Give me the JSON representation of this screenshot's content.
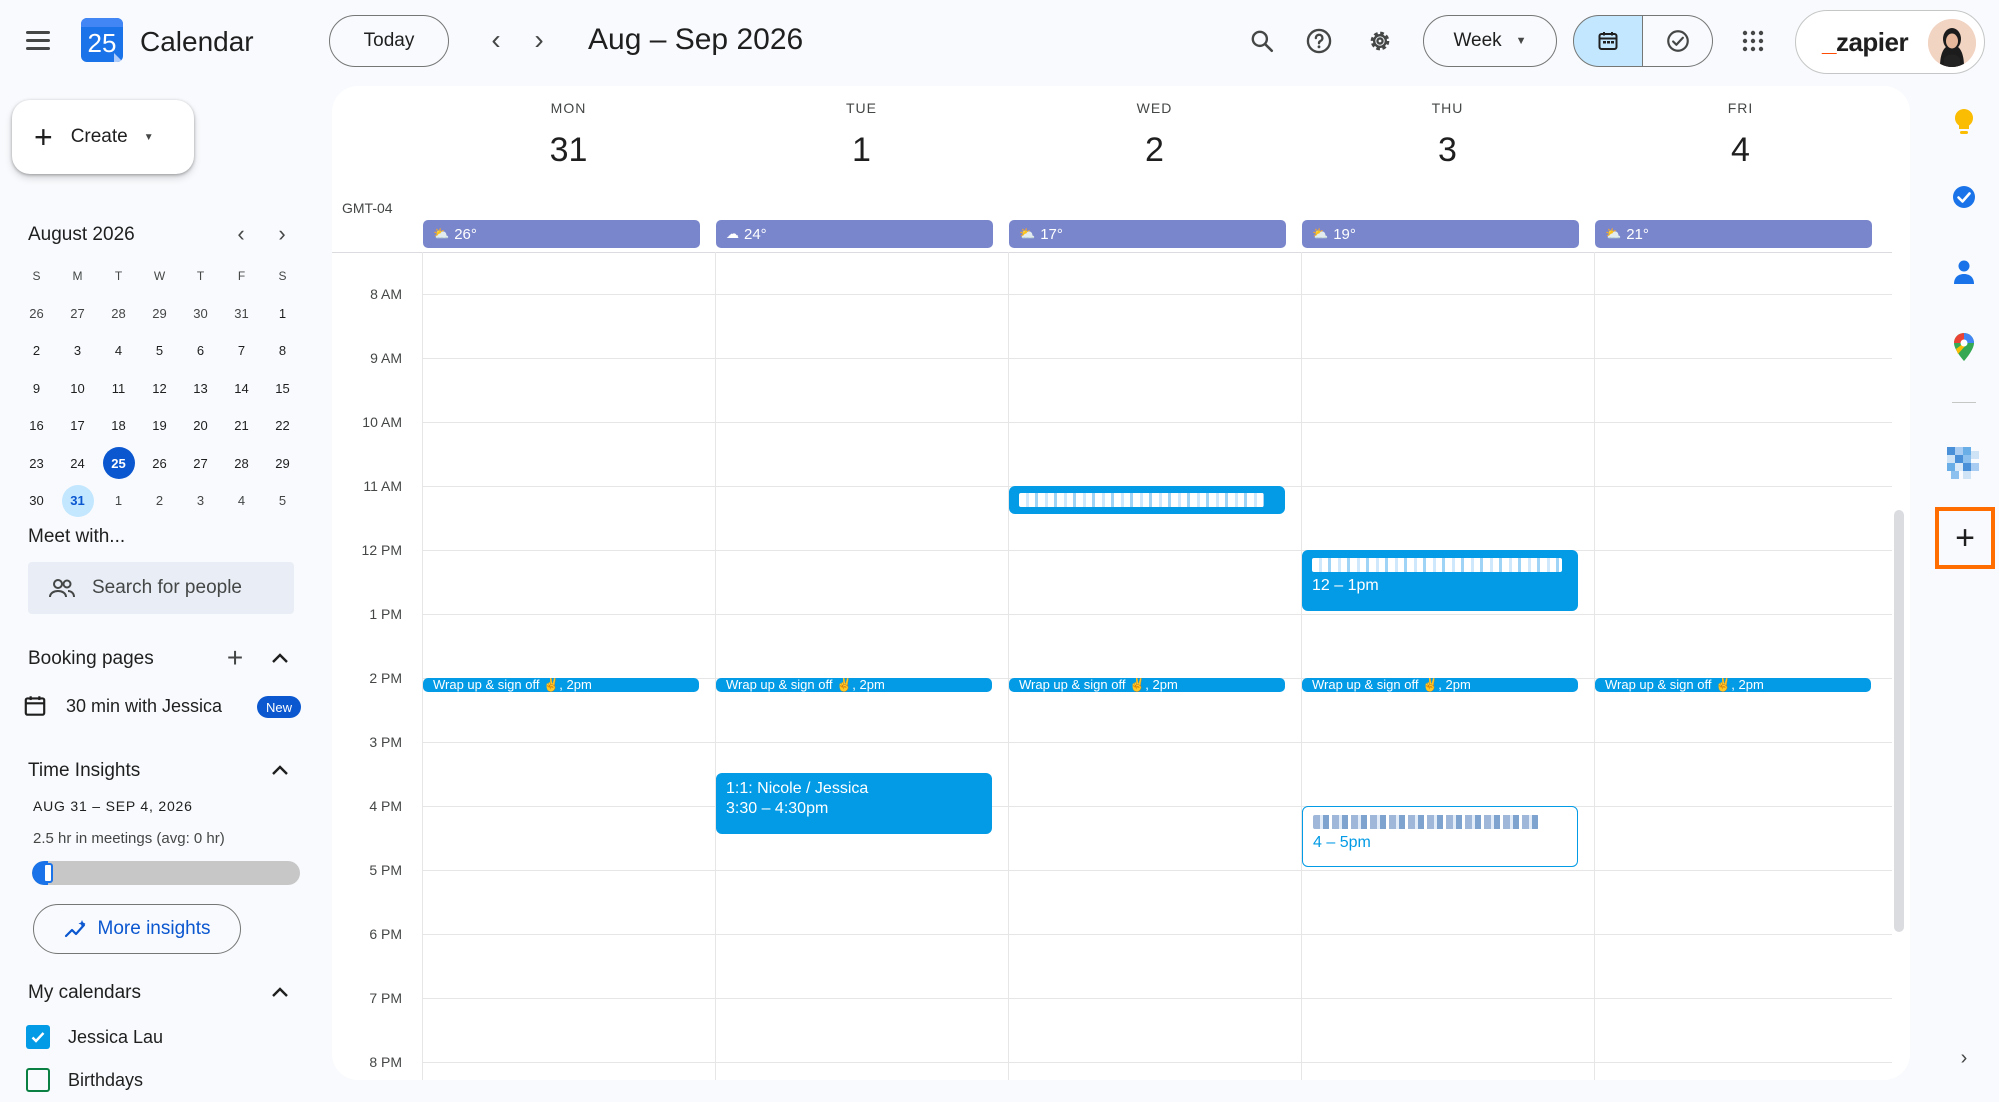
{
  "app": {
    "title": "Calendar",
    "logo_number": "25"
  },
  "header": {
    "today_label": "Today",
    "prev_label": "‹",
    "next_label": "›",
    "date_range": "Aug – Sep 2026",
    "view_label": "Week",
    "account_brand": "zapier"
  },
  "sidebar": {
    "create_label": "Create",
    "mini_month": "August 2026",
    "dow": [
      "S",
      "M",
      "T",
      "W",
      "T",
      "F",
      "S"
    ],
    "weeks": [
      [
        "26",
        "27",
        "28",
        "29",
        "30",
        "31",
        "1"
      ],
      [
        "2",
        "3",
        "4",
        "5",
        "6",
        "7",
        "8"
      ],
      [
        "9",
        "10",
        "11",
        "12",
        "13",
        "14",
        "15"
      ],
      [
        "16",
        "17",
        "18",
        "19",
        "20",
        "21",
        "22"
      ],
      [
        "23",
        "24",
        "25",
        "26",
        "27",
        "28",
        "29"
      ],
      [
        "30",
        "31",
        "1",
        "2",
        "3",
        "4",
        "5"
      ]
    ],
    "meet_with": "Meet with...",
    "search_people": "Search for people",
    "booking_pages": "Booking pages",
    "booking_item": "30 min with Jessica",
    "new_badge": "New",
    "time_insights": "Time Insights",
    "insights_range": "AUG 31 – SEP 4, 2026",
    "insights_meetings": "2.5 hr in meetings (avg: 0 hr)",
    "insights_progress": 0.06,
    "more_insights": "More insights",
    "my_calendars": "My calendars",
    "calendars": [
      {
        "label": "Jessica Lau",
        "checked": true,
        "color": "#039be5"
      },
      {
        "label": "Birthdays",
        "checked": false,
        "color": "#0b8043"
      }
    ]
  },
  "week": {
    "timezone": "GMT-04",
    "days": [
      {
        "dow": "MON",
        "num": "31",
        "weather": "26°"
      },
      {
        "dow": "TUE",
        "num": "1",
        "weather": "24°"
      },
      {
        "dow": "WED",
        "num": "2",
        "weather": "17°"
      },
      {
        "dow": "THU",
        "num": "3",
        "weather": "19°"
      },
      {
        "dow": "FRI",
        "num": "4",
        "weather": "21°"
      }
    ],
    "hours": [
      "8 AM",
      "9 AM",
      "10 AM",
      "11 AM",
      "12 PM",
      "1 PM",
      "2 PM",
      "3 PM",
      "4 PM",
      "5 PM",
      "6 PM",
      "7 PM",
      "8 PM"
    ],
    "events": {
      "wrapup": "Wrap up & sign off ✌️, 2pm",
      "nicole_title": "1:1: Nicole / Jessica",
      "nicole_time": "3:30 – 4:30pm",
      "thu_noon_time": "12 – 1pm",
      "thu_four_time": "4 – 5pm"
    }
  },
  "colors": {
    "event": "#039be5",
    "weather": "#7986cb",
    "accent": "#0b57d0",
    "highlight": "#ff6d00"
  }
}
